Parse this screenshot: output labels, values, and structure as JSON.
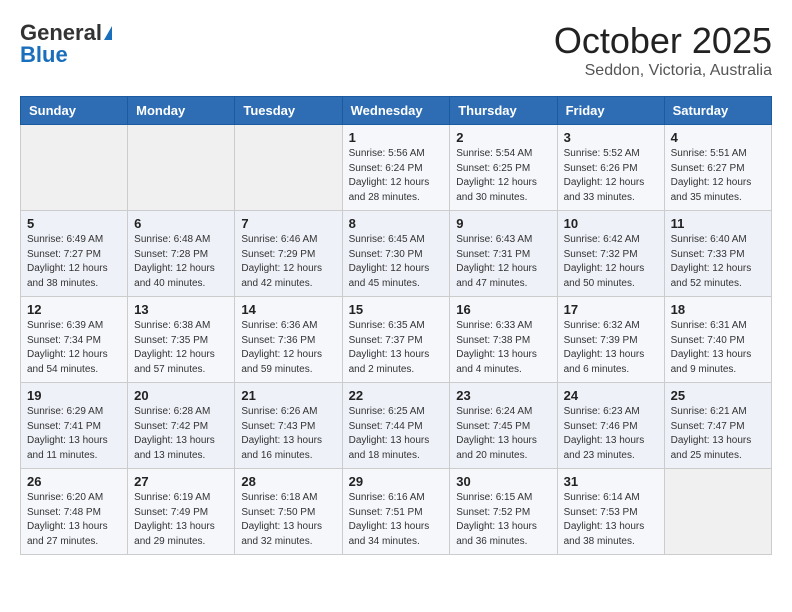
{
  "header": {
    "logo_line1": "General",
    "logo_line2": "Blue",
    "month_title": "October 2025",
    "location": "Seddon, Victoria, Australia"
  },
  "days_of_week": [
    "Sunday",
    "Monday",
    "Tuesday",
    "Wednesday",
    "Thursday",
    "Friday",
    "Saturday"
  ],
  "weeks": [
    [
      {
        "day": "",
        "info": ""
      },
      {
        "day": "",
        "info": ""
      },
      {
        "day": "",
        "info": ""
      },
      {
        "day": "1",
        "info": "Sunrise: 5:56 AM\nSunset: 6:24 PM\nDaylight: 12 hours\nand 28 minutes."
      },
      {
        "day": "2",
        "info": "Sunrise: 5:54 AM\nSunset: 6:25 PM\nDaylight: 12 hours\nand 30 minutes."
      },
      {
        "day": "3",
        "info": "Sunrise: 5:52 AM\nSunset: 6:26 PM\nDaylight: 12 hours\nand 33 minutes."
      },
      {
        "day": "4",
        "info": "Sunrise: 5:51 AM\nSunset: 6:27 PM\nDaylight: 12 hours\nand 35 minutes."
      }
    ],
    [
      {
        "day": "5",
        "info": "Sunrise: 6:49 AM\nSunset: 7:27 PM\nDaylight: 12 hours\nand 38 minutes."
      },
      {
        "day": "6",
        "info": "Sunrise: 6:48 AM\nSunset: 7:28 PM\nDaylight: 12 hours\nand 40 minutes."
      },
      {
        "day": "7",
        "info": "Sunrise: 6:46 AM\nSunset: 7:29 PM\nDaylight: 12 hours\nand 42 minutes."
      },
      {
        "day": "8",
        "info": "Sunrise: 6:45 AM\nSunset: 7:30 PM\nDaylight: 12 hours\nand 45 minutes."
      },
      {
        "day": "9",
        "info": "Sunrise: 6:43 AM\nSunset: 7:31 PM\nDaylight: 12 hours\nand 47 minutes."
      },
      {
        "day": "10",
        "info": "Sunrise: 6:42 AM\nSunset: 7:32 PM\nDaylight: 12 hours\nand 50 minutes."
      },
      {
        "day": "11",
        "info": "Sunrise: 6:40 AM\nSunset: 7:33 PM\nDaylight: 12 hours\nand 52 minutes."
      }
    ],
    [
      {
        "day": "12",
        "info": "Sunrise: 6:39 AM\nSunset: 7:34 PM\nDaylight: 12 hours\nand 54 minutes."
      },
      {
        "day": "13",
        "info": "Sunrise: 6:38 AM\nSunset: 7:35 PM\nDaylight: 12 hours\nand 57 minutes."
      },
      {
        "day": "14",
        "info": "Sunrise: 6:36 AM\nSunset: 7:36 PM\nDaylight: 12 hours\nand 59 minutes."
      },
      {
        "day": "15",
        "info": "Sunrise: 6:35 AM\nSunset: 7:37 PM\nDaylight: 13 hours\nand 2 minutes."
      },
      {
        "day": "16",
        "info": "Sunrise: 6:33 AM\nSunset: 7:38 PM\nDaylight: 13 hours\nand 4 minutes."
      },
      {
        "day": "17",
        "info": "Sunrise: 6:32 AM\nSunset: 7:39 PM\nDaylight: 13 hours\nand 6 minutes."
      },
      {
        "day": "18",
        "info": "Sunrise: 6:31 AM\nSunset: 7:40 PM\nDaylight: 13 hours\nand 9 minutes."
      }
    ],
    [
      {
        "day": "19",
        "info": "Sunrise: 6:29 AM\nSunset: 7:41 PM\nDaylight: 13 hours\nand 11 minutes."
      },
      {
        "day": "20",
        "info": "Sunrise: 6:28 AM\nSunset: 7:42 PM\nDaylight: 13 hours\nand 13 minutes."
      },
      {
        "day": "21",
        "info": "Sunrise: 6:26 AM\nSunset: 7:43 PM\nDaylight: 13 hours\nand 16 minutes."
      },
      {
        "day": "22",
        "info": "Sunrise: 6:25 AM\nSunset: 7:44 PM\nDaylight: 13 hours\nand 18 minutes."
      },
      {
        "day": "23",
        "info": "Sunrise: 6:24 AM\nSunset: 7:45 PM\nDaylight: 13 hours\nand 20 minutes."
      },
      {
        "day": "24",
        "info": "Sunrise: 6:23 AM\nSunset: 7:46 PM\nDaylight: 13 hours\nand 23 minutes."
      },
      {
        "day": "25",
        "info": "Sunrise: 6:21 AM\nSunset: 7:47 PM\nDaylight: 13 hours\nand 25 minutes."
      }
    ],
    [
      {
        "day": "26",
        "info": "Sunrise: 6:20 AM\nSunset: 7:48 PM\nDaylight: 13 hours\nand 27 minutes."
      },
      {
        "day": "27",
        "info": "Sunrise: 6:19 AM\nSunset: 7:49 PM\nDaylight: 13 hours\nand 29 minutes."
      },
      {
        "day": "28",
        "info": "Sunrise: 6:18 AM\nSunset: 7:50 PM\nDaylight: 13 hours\nand 32 minutes."
      },
      {
        "day": "29",
        "info": "Sunrise: 6:16 AM\nSunset: 7:51 PM\nDaylight: 13 hours\nand 34 minutes."
      },
      {
        "day": "30",
        "info": "Sunrise: 6:15 AM\nSunset: 7:52 PM\nDaylight: 13 hours\nand 36 minutes."
      },
      {
        "day": "31",
        "info": "Sunrise: 6:14 AM\nSunset: 7:53 PM\nDaylight: 13 hours\nand 38 minutes."
      },
      {
        "day": "",
        "info": ""
      }
    ]
  ]
}
